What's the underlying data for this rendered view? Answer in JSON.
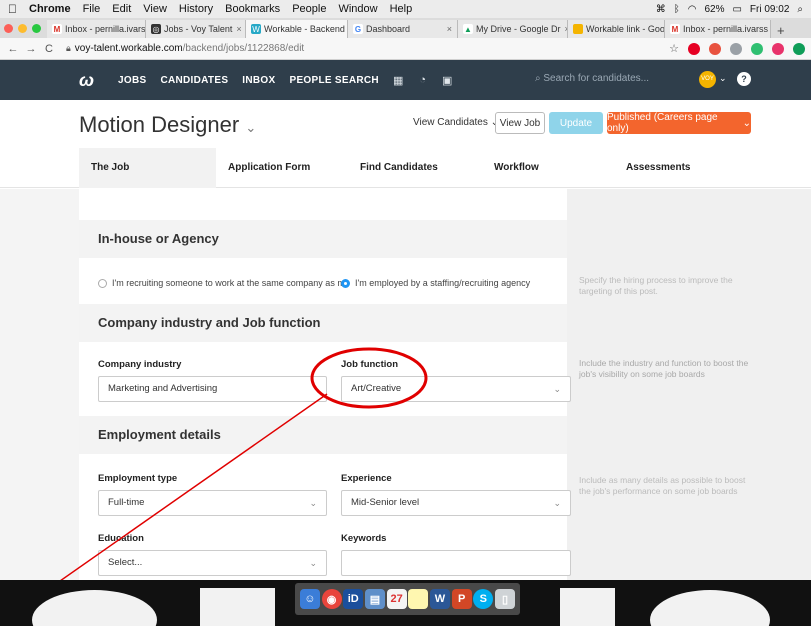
{
  "mac_menu": {
    "app": "Chrome",
    "items": [
      "File",
      "Edit",
      "View",
      "History",
      "Bookmarks",
      "People",
      "Window",
      "Help"
    ],
    "battery": "62%",
    "clock": "Fri 09:02"
  },
  "browser_tabs": [
    {
      "label": "Inbox - pernilla.ivarss",
      "fav": "M",
      "color": "#d93025"
    },
    {
      "label": "Jobs - Voy Talent",
      "fav": "◎",
      "color": "#333333"
    },
    {
      "label": "Workable - Backend",
      "fav": "W",
      "color": "#27a9c7",
      "active": true
    },
    {
      "label": "Dashboard",
      "fav": "G",
      "color": "#4285f4"
    },
    {
      "label": "My Drive - Google Dr",
      "fav": "▲",
      "color": "#0f9d58"
    },
    {
      "label": "Workable link - Goog",
      "fav": "▢",
      "color": "#f4b400"
    },
    {
      "label": "Inbox - pernilla.ivarss",
      "fav": "M",
      "color": "#d93025"
    }
  ],
  "address": {
    "host": "voy-talent.workable.com",
    "path": "/backend/jobs/1122868/edit"
  },
  "nav": {
    "links": [
      "JOBS",
      "CANDIDATES",
      "INBOX",
      "PEOPLE SEARCH"
    ],
    "search_placeholder": "Search for candidates...",
    "avatar_text": "VOY"
  },
  "header": {
    "job_title": "Motion Designer",
    "view_candidates": "View Candidates",
    "view_job": "View Job",
    "update": "Update",
    "published": "Published (Careers page only)"
  },
  "tabs": [
    "The Job",
    "Application Form",
    "Find Candidates",
    "Workflow",
    "Assessments"
  ],
  "sections": {
    "inhouse": {
      "title": "In-house or Agency",
      "option_1": "I'm recruiting someone to work at the same company as me",
      "option_2": "I'm employed by a staffing/recruiting agency",
      "hint": "Specify the hiring process to improve the targeting of this post."
    },
    "industry": {
      "title": "Company industry and Job function",
      "industry_label": "Company industry",
      "industry_value": "Marketing and Advertising",
      "function_label": "Job function",
      "function_value": "Art/Creative",
      "hint": "Include the industry and function to boost the job's visibility on some job boards"
    },
    "employment": {
      "title": "Employment details",
      "type_label": "Employment type",
      "type_value": "Full-time",
      "experience_label": "Experience",
      "experience_value": "Mid-Senior level",
      "education_label": "Education",
      "education_value": "Select...",
      "keywords_label": "Keywords",
      "keywords_value": "",
      "hint": "Include as many details as possible to boost the job's performance on some job boards"
    }
  },
  "colors": {
    "nav_bg": "#2f3e4b",
    "published": "#f3652d",
    "update": "#8fd4ea",
    "annotation": "#e00000"
  }
}
